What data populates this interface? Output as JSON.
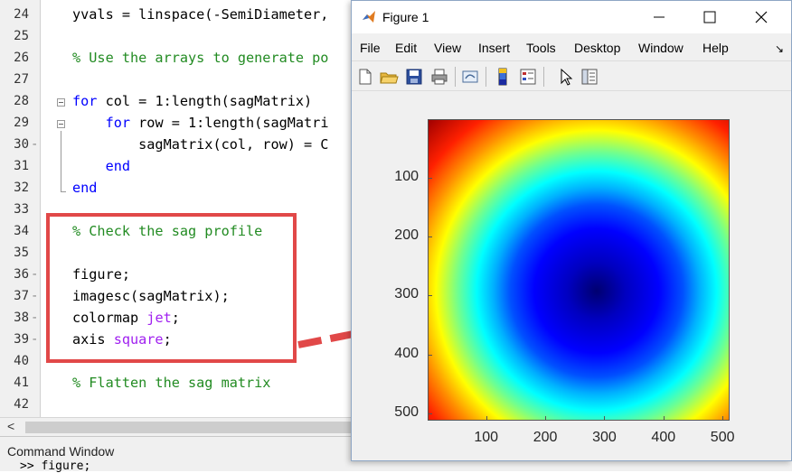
{
  "editor": {
    "lines": [
      {
        "num": "24",
        "code": [
          {
            "t": "yvals = linspace(-SemiDiameter,",
            "c": ""
          }
        ]
      },
      {
        "num": "25",
        "code": []
      },
      {
        "num": "26",
        "code": [
          {
            "t": "% Use the arrays to generate po",
            "c": "cm"
          }
        ]
      },
      {
        "num": "27",
        "code": []
      },
      {
        "num": "28",
        "code": [
          {
            "t": "for",
            "c": "kw"
          },
          {
            "t": " col = 1:length(sagMatrix)",
            "c": ""
          }
        ]
      },
      {
        "num": "29",
        "code": [
          {
            "t": "    ",
            "c": ""
          },
          {
            "t": "for",
            "c": "kw"
          },
          {
            "t": " row = 1:length(sagMatri",
            "c": ""
          }
        ]
      },
      {
        "num": "30",
        "code": [
          {
            "t": "        sagMatrix(col, row) = C",
            "c": ""
          }
        ]
      },
      {
        "num": "31",
        "code": [
          {
            "t": "    ",
            "c": ""
          },
          {
            "t": "end",
            "c": "kw"
          }
        ]
      },
      {
        "num": "32",
        "code": [
          {
            "t": "end",
            "c": "kw"
          }
        ]
      },
      {
        "num": "33",
        "code": []
      },
      {
        "num": "34",
        "code": [
          {
            "t": "% Check the sag profile",
            "c": "cm"
          }
        ]
      },
      {
        "num": "35",
        "code": []
      },
      {
        "num": "36",
        "code": [
          {
            "t": "figure;",
            "c": ""
          }
        ]
      },
      {
        "num": "37",
        "code": [
          {
            "t": "imagesc(sagMatrix);",
            "c": ""
          }
        ]
      },
      {
        "num": "38",
        "code": [
          {
            "t": "colormap ",
            "c": ""
          },
          {
            "t": "jet",
            "c": "str"
          },
          {
            "t": ";",
            "c": ""
          }
        ]
      },
      {
        "num": "39",
        "code": [
          {
            "t": "axis ",
            "c": ""
          },
          {
            "t": "square",
            "c": "str"
          },
          {
            "t": ";",
            "c": ""
          }
        ]
      },
      {
        "num": "40",
        "code": []
      },
      {
        "num": "41",
        "code": [
          {
            "t": "% Flatten the sag matrix",
            "c": "cm"
          }
        ]
      },
      {
        "num": "42",
        "code": []
      }
    ],
    "dash_lines": [
      "30",
      "36",
      "37",
      "38",
      "39"
    ],
    "scroll_left_arrow": "<"
  },
  "command_window": {
    "title": "Command Window",
    "peek_text": ">> figure;"
  },
  "figure": {
    "title": "Figure 1",
    "menu": [
      "File",
      "Edit",
      "View",
      "Insert",
      "Tools",
      "Desktop",
      "Window",
      "Help"
    ],
    "overflow_arrow": "↘",
    "toolbar_icons": [
      "new-figure-icon",
      "open-file-icon",
      "save-icon",
      "print-icon",
      "link-plot-icon",
      "insert-colorbar-icon",
      "insert-legend-icon",
      "select-pointer-icon",
      "property-editor-icon"
    ],
    "colors": {
      "annotation_red": "#e14848"
    }
  },
  "chart_data": {
    "type": "heatmap",
    "colormap": "jet",
    "xticks": [
      100,
      200,
      300,
      400,
      500
    ],
    "yticks": [
      100,
      200,
      300,
      400,
      500
    ],
    "xlim": [
      1,
      512
    ],
    "ylim": [
      1,
      512
    ],
    "y_reversed": true,
    "axis": "square",
    "pattern": "radial bowl: minimum near center, maximum at corners"
  }
}
